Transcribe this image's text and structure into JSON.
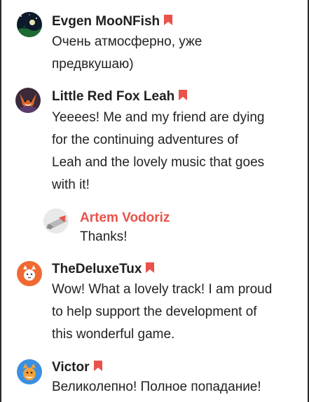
{
  "comments": [
    {
      "author": "Evgen MooNFish",
      "avatar_icon": "night-sky-avatar",
      "text": "Очень атмосферно, уже\nпредвкушаю)"
    },
    {
      "author": "Little Red Fox Leah",
      "avatar_icon": "fox-avatar",
      "text": "Yeeees! Me and my friend are dying\nfor the continuing adventures of\nLeah and the lovely music that goes\nwith it!"
    },
    {
      "author": "Artem Vodoriz",
      "avatar_icon": "rocket-avatar",
      "text": "Thanks!",
      "is_reply": true
    },
    {
      "author": "TheDeluxeTux",
      "avatar_icon": "orange-cat-avatar",
      "text": "Wow! What a lovely track! I am proud\nto help support the development of\nthis wonderful game."
    },
    {
      "author": "Victor",
      "avatar_icon": "blue-cat-avatar",
      "text": "Великолепно! Полное попадание!"
    }
  ],
  "colors": {
    "accent": "#e9524a",
    "name": "#1f1f1f",
    "text": "#222222",
    "frame": "#2b2b2b"
  },
  "icons": {
    "supporter_badge": "bookmark-icon"
  }
}
